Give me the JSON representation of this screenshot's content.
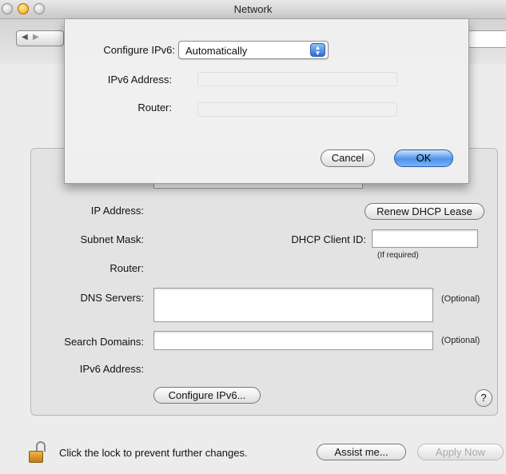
{
  "window": {
    "title": "Network"
  },
  "panel": {
    "ip_address_label": "IP Address:",
    "subnet_mask_label": "Subnet Mask:",
    "router_label": "Router:",
    "dns_servers_label": "DNS Servers:",
    "search_domains_label": "Search Domains:",
    "ipv6_address_label": "IPv6 Address:",
    "renew_dhcp_label": "Renew DHCP Lease",
    "dhcp_client_id_label": "DHCP Client ID:",
    "if_required_note": "(If required)",
    "optional_note_dns": "(Optional)",
    "optional_note_search": "(Optional)",
    "configure_ipv6_button": "Configure IPv6...",
    "help_label": "?"
  },
  "footer": {
    "lock_text": "Click the lock to prevent further changes.",
    "assist_button": "Assist me...",
    "apply_button": "Apply Now"
  },
  "sheet": {
    "configure_label": "Configure IPv6:",
    "configure_value": "Automatically",
    "ipv6_address_label": "IPv6 Address:",
    "router_label": "Router:",
    "cancel_button": "Cancel",
    "ok_button": "OK"
  },
  "colors": {
    "accent": "#4f93ea",
    "window_bg": "#ececec",
    "panel_bg": "#e3e3e3"
  },
  "icons": [
    "back-arrow-icon",
    "forward-arrow-icon",
    "lock-icon",
    "help-icon",
    "stepper-icon"
  ]
}
